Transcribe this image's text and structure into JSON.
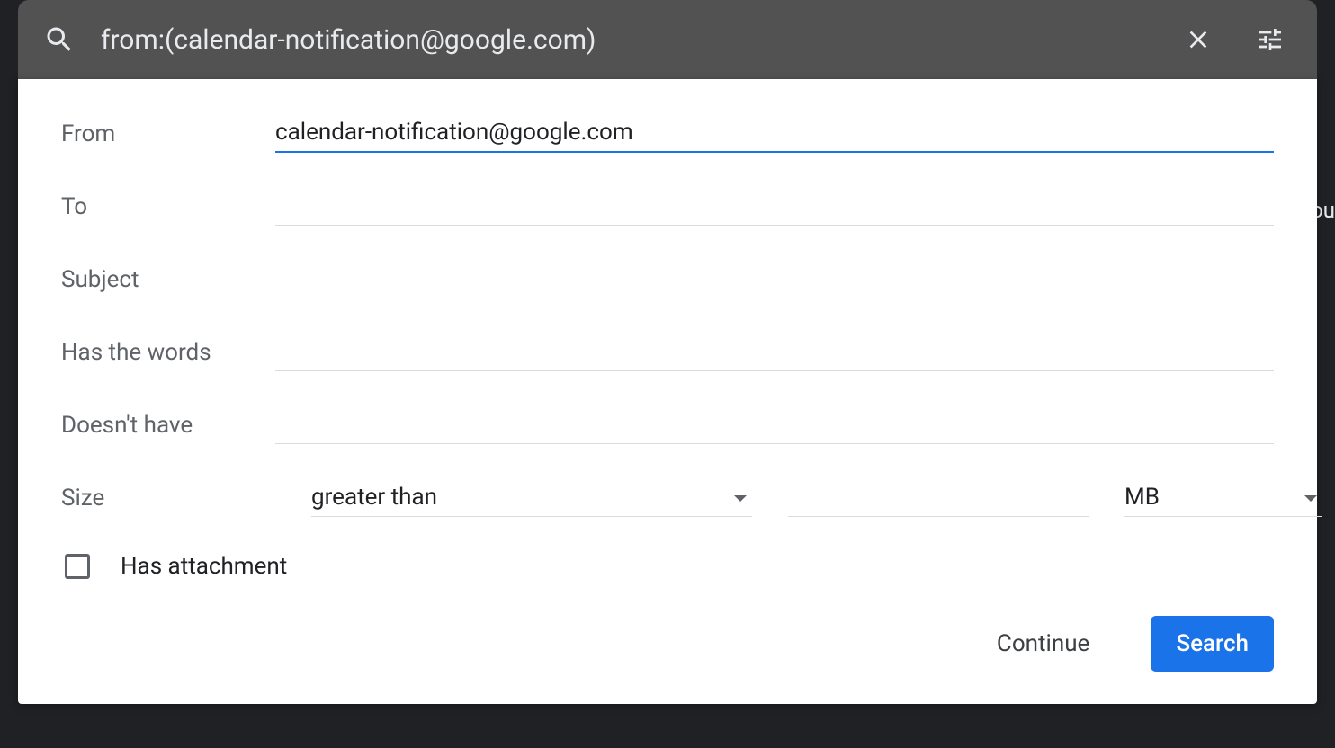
{
  "search": {
    "query": "from:(calendar-notification@google.com)"
  },
  "filter": {
    "from": {
      "label": "From",
      "value": "calendar-notification@google.com"
    },
    "to": {
      "label": "To",
      "value": ""
    },
    "subject": {
      "label": "Subject",
      "value": ""
    },
    "has_words": {
      "label": "Has the words",
      "value": ""
    },
    "doesnt_have": {
      "label": "Doesn't have",
      "value": ""
    },
    "size": {
      "label": "Size",
      "comparator": "greater than",
      "value": "",
      "unit": "MB"
    },
    "has_attachment": {
      "label": "Has attachment",
      "checked": false
    }
  },
  "buttons": {
    "continue": "Continue",
    "search": "Search"
  },
  "bg_peek": "ou"
}
